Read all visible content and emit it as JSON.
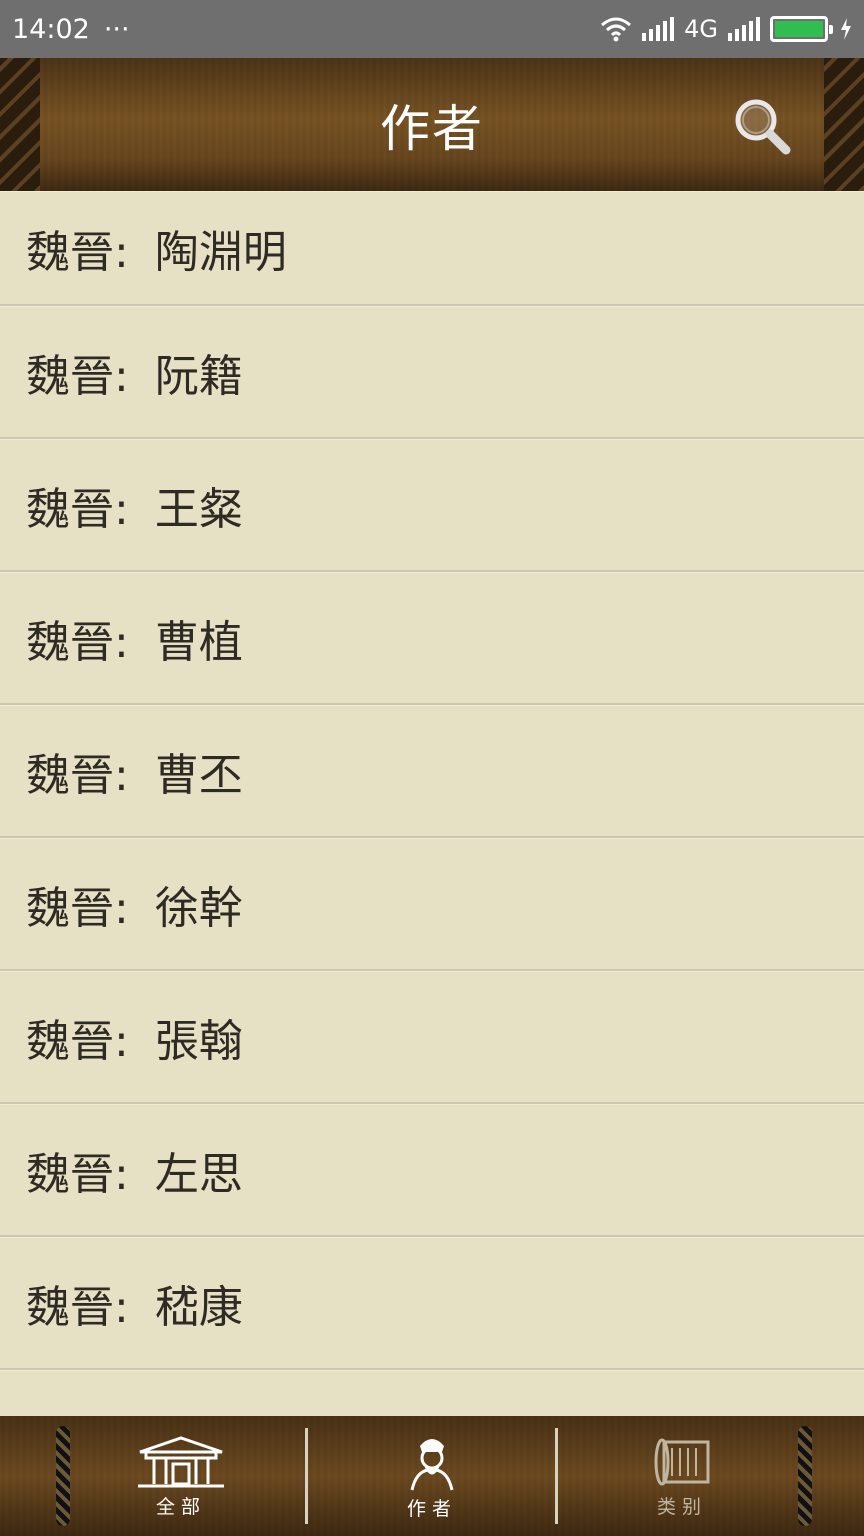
{
  "status_bar": {
    "time": "14:02",
    "more": "···",
    "network": "4G"
  },
  "header": {
    "title": "作者",
    "search_icon": "search-icon"
  },
  "list": {
    "items": [
      {
        "dynasty": "魏晉:",
        "name": "陶淵明"
      },
      {
        "dynasty": "魏晉:",
        "name": "阮籍"
      },
      {
        "dynasty": "魏晉:",
        "name": "王粲"
      },
      {
        "dynasty": "魏晉:",
        "name": "曹植"
      },
      {
        "dynasty": "魏晉:",
        "name": "曹丕"
      },
      {
        "dynasty": "魏晉:",
        "name": "徐幹"
      },
      {
        "dynasty": "魏晉:",
        "name": "張翰"
      },
      {
        "dynasty": "魏晉:",
        "name": "左思"
      },
      {
        "dynasty": "魏晉:",
        "name": "嵇康"
      }
    ]
  },
  "bottom_nav": {
    "tabs": [
      {
        "label": "全部",
        "icon": "building-icon"
      },
      {
        "label": "作者",
        "icon": "poet-portrait-icon"
      },
      {
        "label": "类别",
        "icon": "scroll-icon"
      }
    ]
  },
  "colors": {
    "list_background": "#e6e0c4",
    "header_wood": "#7a5524",
    "battery_green": "#2fbf4f"
  }
}
